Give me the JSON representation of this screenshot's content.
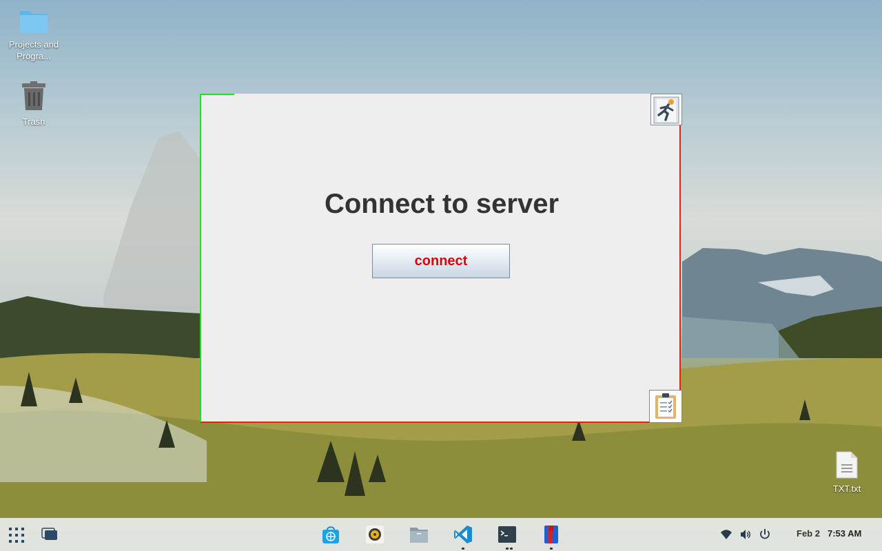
{
  "desktop": {
    "icons": [
      {
        "label": "Projects and Progra..."
      },
      {
        "label": "Trash"
      },
      {
        "label": "TXT.txt"
      }
    ]
  },
  "app": {
    "heading": "Connect to server",
    "connect_label": "connect",
    "exit_icon": "exit-running-man-icon",
    "clipboard_icon": "clipboard-checklist-icon",
    "colors": {
      "border_left": "#22dd22",
      "border_right": "#e02020",
      "button_text": "#e00000"
    }
  },
  "taskbar": {
    "launcher_icon": "app-grid-icon",
    "windows_icon": "window-switcher-icon",
    "apps": [
      {
        "name": "software-store-icon"
      },
      {
        "name": "music-player-icon"
      },
      {
        "name": "file-manager-icon"
      },
      {
        "name": "vscode-icon"
      },
      {
        "name": "terminal-icon"
      },
      {
        "name": "bookmark-app-icon"
      }
    ],
    "tray": [
      "wifi-icon",
      "volume-icon",
      "power-icon"
    ],
    "date": "Feb 2",
    "time": "7:53 AM"
  }
}
